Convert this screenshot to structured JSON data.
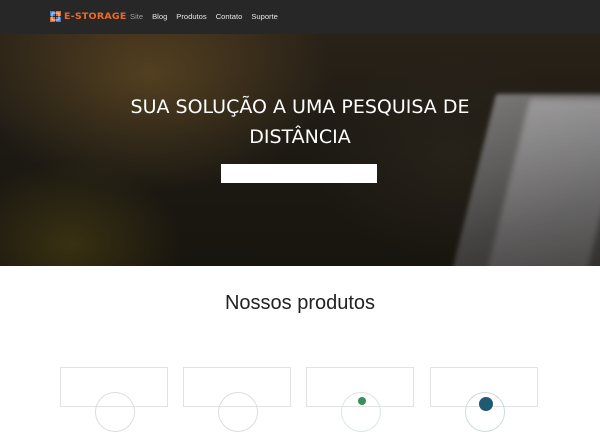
{
  "brand": {
    "logo_text": "e-storage",
    "accent": "#ee6b27"
  },
  "nav": {
    "items": [
      {
        "label": "Site",
        "active": true
      },
      {
        "label": "Blog",
        "active": false
      },
      {
        "label": "Produtos",
        "active": false
      },
      {
        "label": "Contato",
        "active": false
      },
      {
        "label": "Suporte",
        "active": false
      }
    ]
  },
  "hero": {
    "title_line1": "SUA SOLUÇÃO A UMA PESQUISA DE",
    "title_line2": "DISTÂNCIA",
    "search_value": ""
  },
  "products": {
    "title": "Nossos produtos",
    "cards": [
      {
        "icon": "product-icon-1"
      },
      {
        "icon": "product-icon-2"
      },
      {
        "icon": "product-icon-3"
      },
      {
        "icon": "product-icon-4"
      }
    ]
  },
  "colors": {
    "navbar": "#272727",
    "accent": "#ee6b27",
    "teal": "#1f5a73"
  }
}
